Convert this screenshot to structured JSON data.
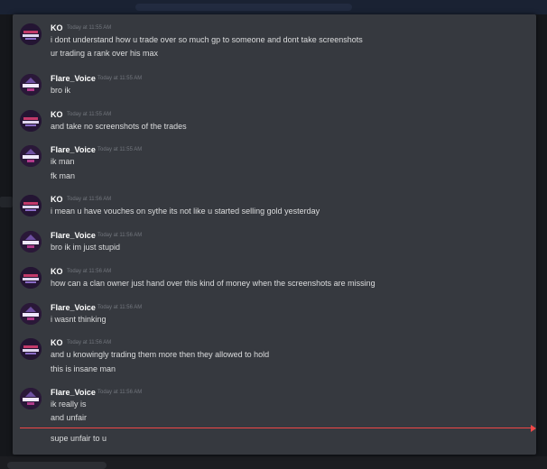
{
  "colors": {
    "background": "#36393f",
    "username": "#ffffff",
    "message_text": "#dcddde",
    "timestamp": "#72767d",
    "new_divider": "#f04747"
  },
  "messages": [
    {
      "author": "KO",
      "avatar": "ko-avatar-icon",
      "timestamp": "Today at 11:55 AM",
      "lines": [
        "i dont understand how u trade over so much gp to someone and dont take screenshots",
        "ur trading a rank  over his max"
      ]
    },
    {
      "author": "Flare_Voice",
      "avatar": "flare-avatar-icon",
      "timestamp": "Today at 11:55 AM",
      "lines": [
        "bro ik"
      ]
    },
    {
      "author": "KO",
      "avatar": "ko-avatar-icon",
      "timestamp": "Today at 11:55 AM",
      "lines": [
        "and take no screenshots of the trades"
      ]
    },
    {
      "author": "Flare_Voice",
      "avatar": "flare-avatar-icon",
      "timestamp": "Today at 11:55 AM",
      "lines": [
        "ik man",
        "fk man"
      ]
    },
    {
      "author": "KO",
      "avatar": "ko-avatar-icon",
      "timestamp": "Today at 11:56 AM",
      "lines": [
        "i mean u have vouches on sythe its not like u started selling gold yesterday"
      ]
    },
    {
      "author": "Flare_Voice",
      "avatar": "flare-avatar-icon",
      "timestamp": "Today at 11:56 AM",
      "lines": [
        "bro ik im just stupid"
      ]
    },
    {
      "author": "KO",
      "avatar": "ko-avatar-icon",
      "timestamp": "Today at 11:56 AM",
      "lines": [
        "how can a clan owner just hand over this kind of money when the screenshots are missing"
      ]
    },
    {
      "author": "Flare_Voice",
      "avatar": "flare-avatar-icon",
      "timestamp": "Today at 11:56 AM",
      "lines": [
        "i wasnt thinking"
      ]
    },
    {
      "author": "KO",
      "avatar": "ko-avatar-icon",
      "timestamp": "Today at 11:56 AM",
      "lines": [
        "and  u knowingly trading them more then they allowed to hold",
        "this is insane man"
      ]
    },
    {
      "author": "Flare_Voice",
      "avatar": "flare-avatar-icon",
      "timestamp": "Today at 11:56 AM",
      "lines": [
        "ik really is",
        "and unfair"
      ]
    }
  ],
  "after_divider": {
    "lines": [
      "supe unfair to u"
    ]
  }
}
